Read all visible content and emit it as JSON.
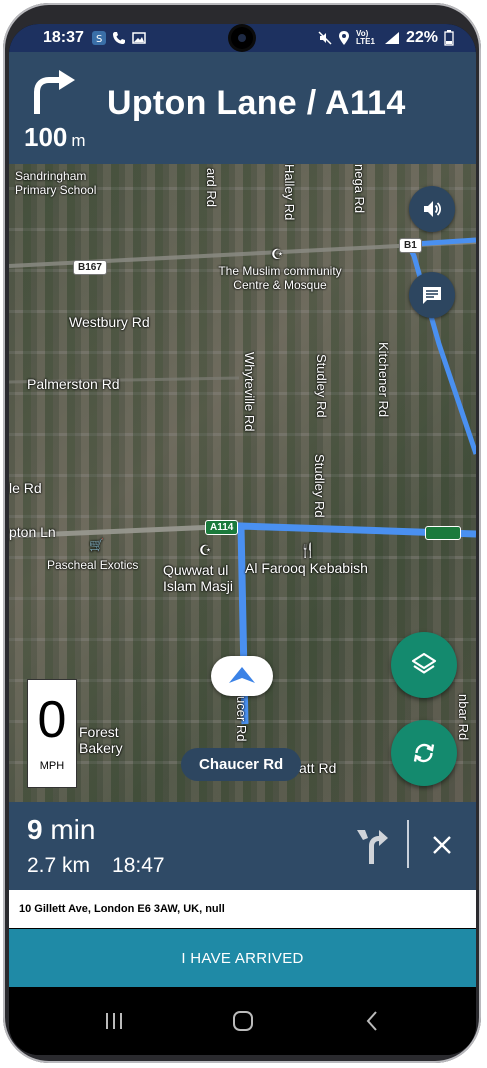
{
  "status_bar": {
    "time": "18:37",
    "battery": "22%",
    "network": "Vo) LTE1",
    "icons": [
      "app-notification-icon",
      "phone-icon",
      "image-icon",
      "mute-icon",
      "location-icon",
      "signal-icon",
      "battery-icon"
    ]
  },
  "nav_header": {
    "distance_value": "100",
    "distance_unit": "m",
    "street_name": "Upton Lane / A114",
    "maneuver_icon": "turn-right-icon"
  },
  "map": {
    "labels": {
      "sandringham": "Sandringham Primary School",
      "muslim_centre": "The Muslim community Centre & Mosque",
      "westbury": "Westbury Rd",
      "palmerston": "Palmerston Rd",
      "wyteville": "Whyteville Rd",
      "studley1": "Studley Rd",
      "studley2": "Studley Rd",
      "kitchener": "Kitchener Rd",
      "le_rd": "le Rd",
      "upton_ln": "pton Ln",
      "pascheal": "Pascheal Exotics",
      "quwwat": "Quwwat ul Islam Masji",
      "alfarooq": "Al Farooq Kebabish",
      "forest_bakery": "Forest Bakery",
      "chaucer_vert": "ucer Rd",
      "att_rd": "att Rd",
      "bar_rd": "nbar Rd",
      "gard_rd": "ard Rd",
      "halley": "Halley Rd",
      "nega": "nega Rd"
    },
    "shields": {
      "b167": "B167",
      "a114": "A114",
      "b1xx": "B1"
    },
    "current_street": "Chaucer Rd",
    "speed": {
      "value": "0",
      "unit": "MPH"
    },
    "route_color": "#4a90f0"
  },
  "trip": {
    "duration_value": "9",
    "duration_unit": "min",
    "distance": "2.7 km",
    "eta": "18:47"
  },
  "address": "10 Gillett Ave, London E6 3AW, UK, null",
  "arrived_label": "I HAVE ARRIVED",
  "colors": {
    "header_bg": "#2f4a66",
    "fab_green": "#148a6e",
    "arrived_bg": "#1f8aa6"
  }
}
